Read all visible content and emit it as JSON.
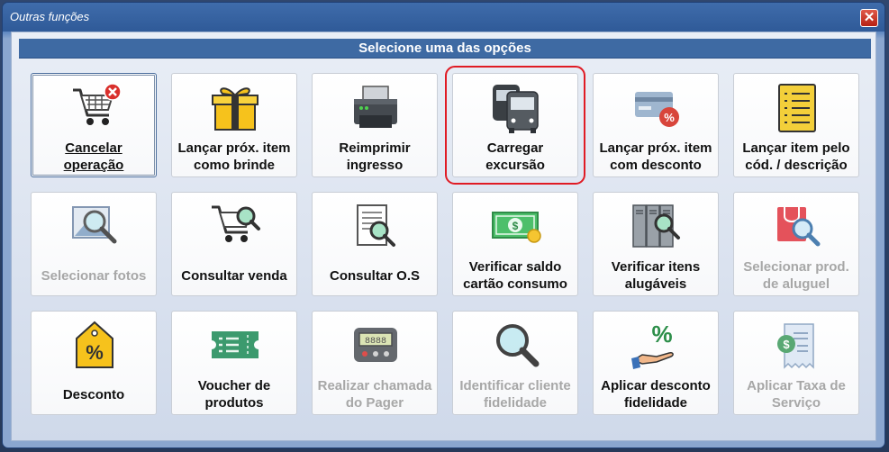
{
  "window": {
    "title": "Outras funções",
    "close_symbol": "✕"
  },
  "header": {
    "text": "Selecione uma das opções"
  },
  "options": [
    {
      "line1": "Cancelar",
      "line2": "operação",
      "icon": "cart-cancel-icon",
      "enabled": true
    },
    {
      "line1": "Lançar próx. item",
      "line2": "como brinde",
      "icon": "gift-icon",
      "enabled": true
    },
    {
      "line1": "Reimprimir",
      "line2": "ingresso",
      "icon": "printer-icon",
      "enabled": true
    },
    {
      "line1": "Carregar",
      "line2": "excursão",
      "icon": "buses-icon",
      "enabled": true
    },
    {
      "line1": "Lançar próx. item",
      "line2": "com desconto",
      "icon": "card-discount-icon",
      "enabled": true
    },
    {
      "line1": "Lançar item pelo",
      "line2": "cód. / descrição",
      "icon": "list-icon",
      "enabled": true
    },
    {
      "line1": "Selecionar fotos",
      "line2": "",
      "icon": "photo-search-icon",
      "enabled": false
    },
    {
      "line1": "Consultar venda",
      "line2": "",
      "icon": "cart-search-icon",
      "enabled": true
    },
    {
      "line1": "Consultar O.S",
      "line2": "",
      "icon": "document-search-icon",
      "enabled": true
    },
    {
      "line1": "Verificar saldo",
      "line2": "cartão consumo",
      "icon": "money-card-icon",
      "enabled": true
    },
    {
      "line1": "Verificar itens",
      "line2": "alugáveis",
      "icon": "lockers-search-icon",
      "enabled": true
    },
    {
      "line1": "Selecionar prod.",
      "line2": "de aluguel",
      "icon": "bag-search-icon",
      "enabled": false
    },
    {
      "line1": "Desconto",
      "line2": "",
      "icon": "percent-tag-icon",
      "enabled": true
    },
    {
      "line1": "Voucher de",
      "line2": "produtos",
      "icon": "voucher-icon",
      "enabled": true
    },
    {
      "line1": "Realizar chamada",
      "line2": "do Pager",
      "icon": "pager-icon",
      "enabled": false
    },
    {
      "line1": "Identificar cliente",
      "line2": "fidelidade",
      "icon": "magnifier-icon",
      "enabled": false
    },
    {
      "line1": "Aplicar desconto",
      "line2": "fidelidade",
      "icon": "hand-percent-icon",
      "enabled": true
    },
    {
      "line1": "Aplicar Taxa de",
      "line2": "Serviço",
      "icon": "receipt-money-icon",
      "enabled": false
    }
  ],
  "colors": {
    "header_bg": "#3e6aa3",
    "highlight": "#e01b24",
    "disabled_text": "#a7a7a7"
  }
}
